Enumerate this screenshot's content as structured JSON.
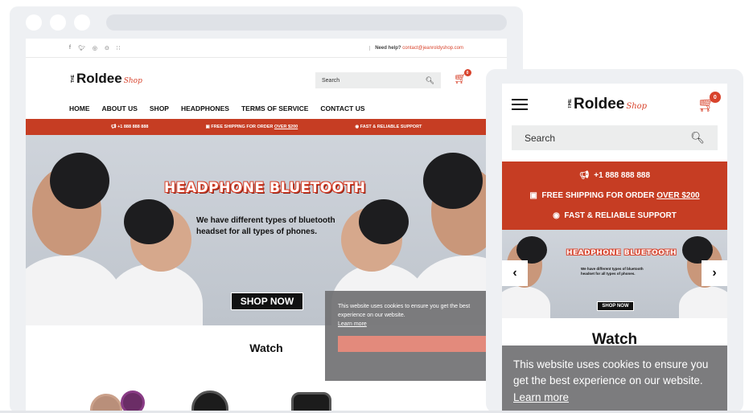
{
  "desktop": {
    "topbar": {
      "social_icons": [
        "f",
        "♥",
        "◎",
        "⊙",
        "≡"
      ],
      "help_label": "Need help?",
      "help_email": "contact@jeanroldyshop.com"
    },
    "logo": {
      "the": "THE",
      "name": "Roldee",
      "script": "Shop"
    },
    "search_placeholder": "Search",
    "cart_count": "0",
    "nav": [
      "HOME",
      "ABOUT US",
      "SHOP",
      "HEADPHONES",
      "TERMS OF SERVICE",
      "CONTACT US"
    ],
    "redbar": {
      "phone": "+1 888 888 888",
      "shipping": "FREE SHIPPING FOR ORDER",
      "shipping_amount": "OVER $200",
      "support": "FAST & RELIABLE SUPPORT"
    },
    "banner": {
      "title": "HEADPHONE BLUETOOTH",
      "subtitle": "We have different types of bluetooth headset for all types of phones.",
      "button": "SHOP NOW"
    },
    "section_title": "Watch",
    "cookie": {
      "text": "This website uses cookies to ensure you get the best experience on our website.",
      "link": "Learn more"
    }
  },
  "mobile": {
    "logo": {
      "the": "THE",
      "name": "Roldee",
      "script": "Shop"
    },
    "cart_count": "0",
    "search_placeholder": "Search",
    "redbar": {
      "phone": "+1 888 888 888",
      "shipping": "FREE SHIPPING FOR ORDER",
      "shipping_amount": "OVER $200",
      "support": "FAST & RELIABLE SUPPORT"
    },
    "banner": {
      "title": "HEADPHONE BLUETOOTH",
      "subtitle": "We have different types of bluetooth headset for all types of phones.",
      "button": "SHOP NOW"
    },
    "section_title": "Watch",
    "cookie": {
      "text": "This website uses cookies to ensure you get the best experience on our website.",
      "link": "Learn more"
    }
  },
  "colors": {
    "accent": "#c63d23",
    "brand_red": "#d8432c",
    "frame": "#eef0f3"
  }
}
